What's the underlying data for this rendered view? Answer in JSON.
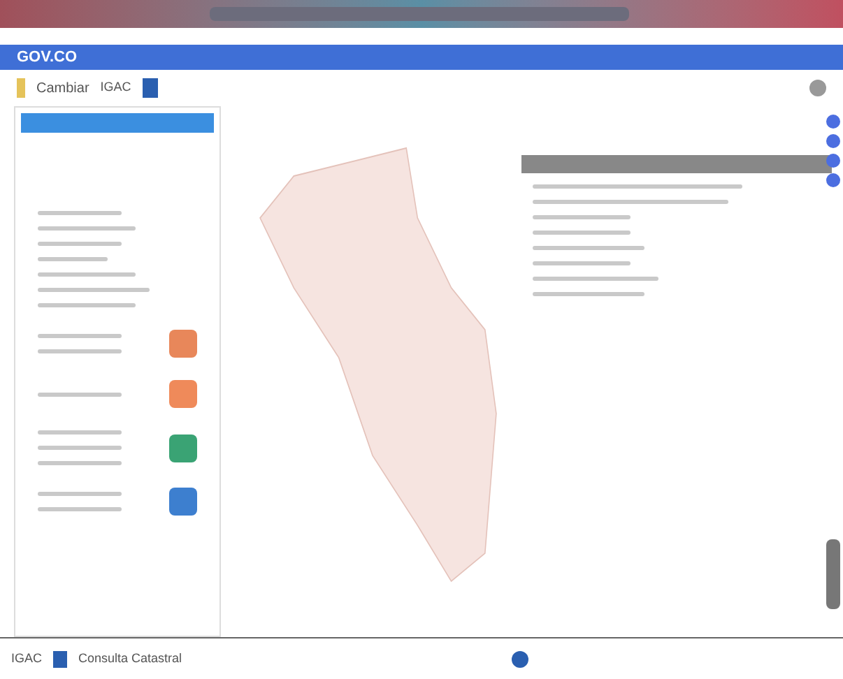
{
  "gov_bar": {
    "logo": "GOV.CO"
  },
  "header": {
    "brand": "Cambiar",
    "agency": "IGAC"
  },
  "left_panel": {
    "cards": [
      {
        "color": "#e8875a"
      },
      {
        "color": "#ef8a5a"
      },
      {
        "color": "#3aa374"
      },
      {
        "color": "#3d7fcf"
      }
    ]
  },
  "footer": {
    "agency": "IGAC",
    "title": "Consulta Catastral"
  }
}
